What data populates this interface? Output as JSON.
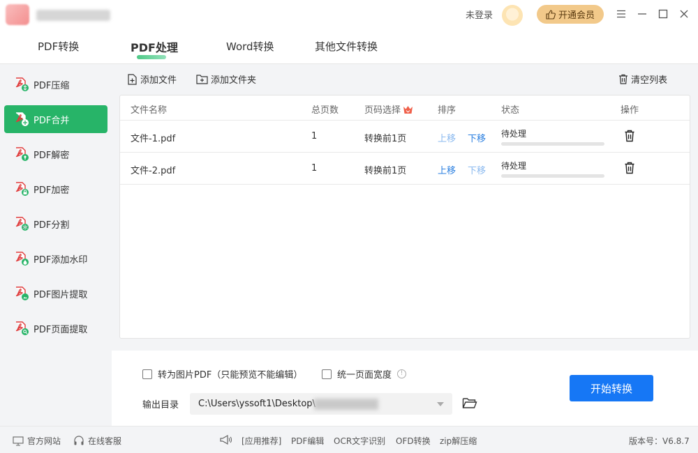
{
  "titlebar": {
    "login_text": "未登录",
    "vip_label": "开通会员"
  },
  "tabs": [
    {
      "label": "PDF转换"
    },
    {
      "label": "PDF处理"
    },
    {
      "label": "Word转换"
    },
    {
      "label": "其他文件转换"
    }
  ],
  "sidebar": {
    "items": [
      {
        "label": "PDF压缩",
        "badge_color": "#27b468"
      },
      {
        "label": "PDF合并",
        "badge_color": "#27b468"
      },
      {
        "label": "PDF解密",
        "badge_color": "#27b468"
      },
      {
        "label": "PDF加密",
        "badge_color": "#27b468"
      },
      {
        "label": "PDF分割",
        "badge_color": "#27b468"
      },
      {
        "label": "PDF添加水印",
        "badge_color": "#27b468"
      },
      {
        "label": "PDF图片提取",
        "badge_color": "#27b468"
      },
      {
        "label": "PDF页面提取",
        "badge_color": "#27b468"
      }
    ]
  },
  "toolbar": {
    "add_file": "添加文件",
    "add_folder": "添加文件夹",
    "clear_list": "清空列表"
  },
  "table": {
    "headers": [
      "文件名称",
      "总页数",
      "页码选择",
      "排序",
      "状态",
      "操作"
    ],
    "rows": [
      {
        "name": "文件-1.pdf",
        "pages": "1",
        "range": "转换前1页",
        "up": "上移",
        "down": "下移",
        "status": "待处理"
      },
      {
        "name": "文件-2.pdf",
        "pages": "1",
        "range": "转换前1页",
        "up": "上移",
        "down": "下移",
        "status": "待处理"
      }
    ]
  },
  "options": {
    "to_image_pdf": "转为图片PDF（只能预览不能编辑）",
    "unify_width": "统一页面宽度",
    "output_label": "输出目录",
    "output_path": "C:\\Users\\yssoft1\\Desktop\\",
    "start_button": "开始转换"
  },
  "footer": {
    "official_site": "官方网站",
    "online_service": "在线客服",
    "recommend": "[应用推荐]",
    "links": [
      "PDF编辑",
      "OCR文字识别",
      "OFD转换",
      "zip解压缩"
    ],
    "version": "版本号：V6.8.7"
  },
  "colors": {
    "accent_green": "#27b468",
    "primary_blue": "#1677f5",
    "vip_gold": "#f2c98a"
  }
}
